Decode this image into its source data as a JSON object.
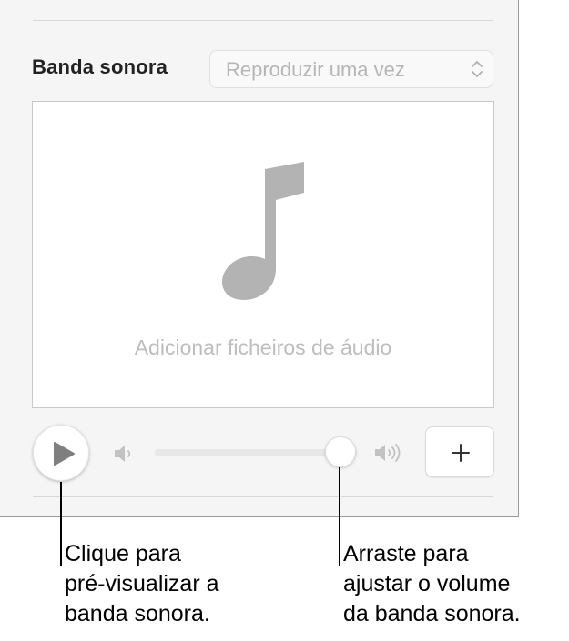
{
  "soundtrack_panel": {
    "title": "Banda sonora",
    "playback_mode": "Reproduzir uma vez",
    "drop_area_text": "Adicionar ficheiros de áudio",
    "volume_level": 0.92,
    "icons": {
      "popup": "chevron-up-down-icon",
      "drop_area": "music-note-icon",
      "play": "play-icon",
      "volume_low": "speaker-low-icon",
      "volume_high": "speaker-high-icon",
      "add": "plus-icon"
    }
  },
  "callouts": {
    "left": {
      "line1": "Clique para",
      "line2": "pré-visualizar a",
      "line3": "banda sonora."
    },
    "right": {
      "line1": "Arraste para",
      "line2": "ajustar o volume",
      "line3": "da banda sonora."
    }
  },
  "colors": {
    "panel_background": "#f5f5f5",
    "placeholder_text": "#bdbdbd",
    "icon_gray": "#b3b3b3"
  }
}
